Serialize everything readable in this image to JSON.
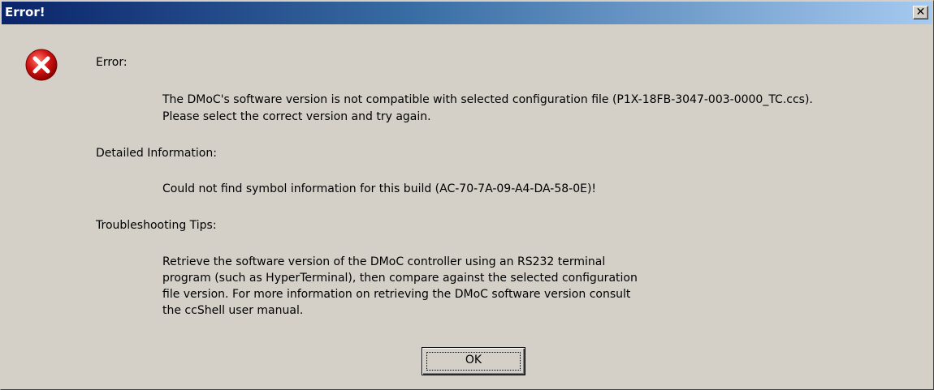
{
  "window": {
    "title": "Error!",
    "close_glyph": "✕",
    "close_icon": "close-icon"
  },
  "dialog": {
    "icon": "error-icon",
    "error_heading": "Error:",
    "error_lines": [
      "The DMoC's software version is not compatible with selected configuration file (P1X-18FB-3047-003-0000_TC.ccs).",
      "Please select the correct version and try again."
    ],
    "detail_heading": "Detailed Information:",
    "detail_line": "Could not find symbol information for this build (AC-70-7A-09-A4-DA-58-0E)!",
    "tips_heading": "Troubleshooting Tips:",
    "tips_lines": [
      "Retrieve the software version of the DMoC controller using an RS232 terminal",
      "program (such as HyperTerminal), then compare against the selected configuration",
      "file version. For more information on retrieving the DMoC software version consult",
      "the ccShell user manual."
    ],
    "ok_label": "OK"
  },
  "colors": {
    "title_gradient_start": "#0a246a",
    "title_gradient_end": "#a6caf0",
    "dialog_background": "#d4d0c8",
    "error_icon_red": "#d21414"
  }
}
